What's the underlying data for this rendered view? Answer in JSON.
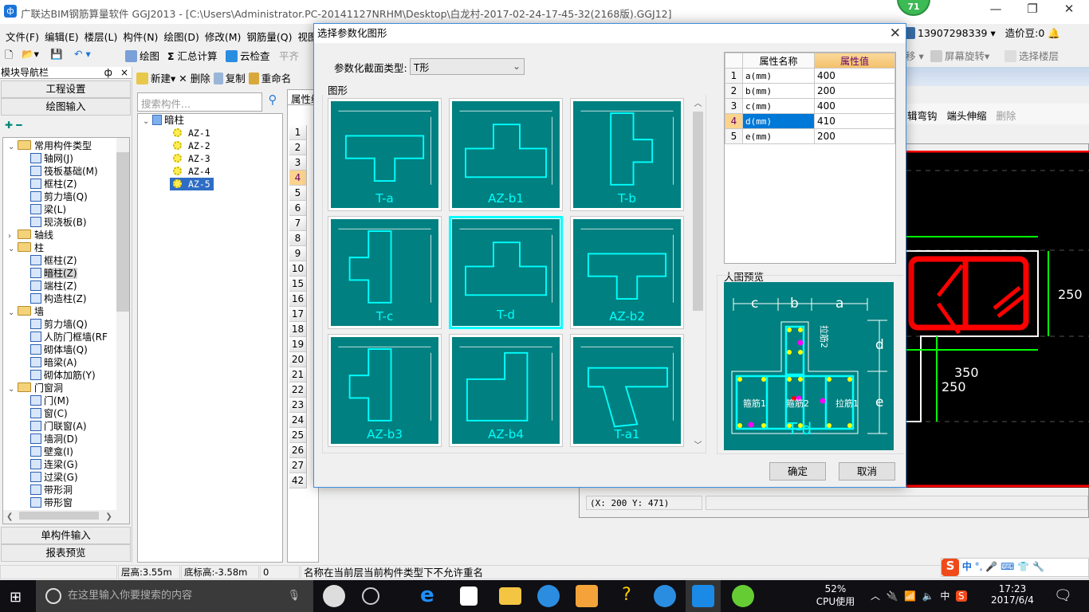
{
  "window": {
    "title": "广联达BIM钢筋算量软件 GGJ2013 - [C:\\Users\\Administrator.PC-20141127NRHM\\Desktop\\白龙村-2017-02-24-17-45-32(2168版).GGJ12]",
    "badge": "71",
    "minimize": "—",
    "restore": "❐",
    "close": "✕"
  },
  "menu": [
    "文件(F)",
    "编辑(E)",
    "楼层(L)",
    "构件(N)",
    "绘图(D)",
    "修改(M)",
    "钢筋量(Q)",
    "视图"
  ],
  "user": {
    "account": "13907298339",
    "beans": "造价豆:0"
  },
  "toolbar": {
    "draw": "绘图",
    "sum_icon": "Σ",
    "sum": "汇总计算",
    "cloud": "云检查",
    "align": "平齐",
    "move": "移",
    "rotate": "屏幕旋转",
    "select_floor": "选择楼层"
  },
  "right_toolbar": {
    "hook": "辑弯钩",
    "extend": "端头伸缩",
    "delete": "删除"
  },
  "leftnav": {
    "title": "模块导航栏",
    "pin": "ф",
    "close": "×",
    "project_settings": "工程设置",
    "draw_input": "绘图输入",
    "single_input": "单构件输入",
    "report": "报表预览",
    "tree": [
      {
        "label": "常用构件类型",
        "folder": true,
        "expanded": true
      },
      {
        "label": "轴网(J)"
      },
      {
        "label": "筏板基础(M)"
      },
      {
        "label": "框柱(Z)"
      },
      {
        "label": "剪力墙(Q)"
      },
      {
        "label": "梁(L)"
      },
      {
        "label": "现浇板(B)"
      },
      {
        "label": "轴线",
        "folder": true,
        "expanded": false
      },
      {
        "label": "柱",
        "folder": true,
        "expanded": true
      },
      {
        "label": "框柱(Z)"
      },
      {
        "label": "暗柱(Z)",
        "selected": true
      },
      {
        "label": "端柱(Z)"
      },
      {
        "label": "构造柱(Z)"
      },
      {
        "label": "墙",
        "folder": true,
        "expanded": true
      },
      {
        "label": "剪力墙(Q)"
      },
      {
        "label": "人防门框墙(RF"
      },
      {
        "label": "砌体墙(Q)"
      },
      {
        "label": "暗梁(A)"
      },
      {
        "label": "砌体加筋(Y)"
      },
      {
        "label": "门窗洞",
        "folder": true,
        "expanded": true
      },
      {
        "label": "门(M)"
      },
      {
        "label": "窗(C)"
      },
      {
        "label": "门联窗(A)"
      },
      {
        "label": "墙洞(D)"
      },
      {
        "label": "壁龛(I)"
      },
      {
        "label": "连梁(G)"
      },
      {
        "label": "过梁(G)"
      },
      {
        "label": "带形洞"
      },
      {
        "label": "带形窗"
      }
    ]
  },
  "components": {
    "new": "新建",
    "delete": "删除",
    "copy": "复制",
    "rename": "重命名",
    "search_placeholder": "搜索构件...",
    "root": "暗柱",
    "items": [
      "AZ-1",
      "AZ-2",
      "AZ-3",
      "AZ-4",
      "AZ-5"
    ],
    "selected": "AZ-5"
  },
  "property_grid": {
    "tab": "属性编",
    "rows": [
      "1",
      "2",
      "3",
      "4",
      "5",
      "6",
      "7",
      "8",
      "9",
      "10",
      "15",
      "16",
      "17",
      "18",
      "19",
      "20",
      "21",
      "22",
      "23",
      "24",
      "25",
      "26",
      "27",
      "42"
    ],
    "selected_row": "4"
  },
  "dialog": {
    "title": "选择参数化图形",
    "close": "✕",
    "type_label": "参数化截面类型:",
    "type_value": "T形",
    "shapes_label": "图形",
    "shapes": [
      "T-a",
      "AZ-b1",
      "T-b",
      "T-c",
      "T-d",
      "AZ-b2",
      "AZ-b3",
      "AZ-b4",
      "T-a1"
    ],
    "selected_shape": "T-d",
    "table": {
      "col_name": "属性名称",
      "col_value": "属性值",
      "rows": [
        {
          "n": "1",
          "name": "a(mm)",
          "value": "400"
        },
        {
          "n": "2",
          "name": "b(mm)",
          "value": "200"
        },
        {
          "n": "3",
          "name": "c(mm)",
          "value": "400"
        },
        {
          "n": "4",
          "name": "d(mm)",
          "value": "410"
        },
        {
          "n": "5",
          "name": "e(mm)",
          "value": "200"
        }
      ]
    },
    "preview_label": "大图预览",
    "preview": {
      "name": "T-d",
      "dims": [
        "c",
        "b",
        "a",
        "d",
        "e"
      ],
      "rebar": [
        "箍筋1",
        "箍筋2",
        "拉筋1",
        "拉筋2"
      ]
    },
    "ok": "确定",
    "cancel": "取消"
  },
  "cad": {
    "dims": [
      "250",
      "350",
      "250"
    ],
    "coords": "(X: 200 Y: 471)"
  },
  "statusbar": {
    "floor_height": "层高:3.55m",
    "base_elev": "底标高:-3.58m",
    "value": "0",
    "message": "名称在当前层当前构件类型下不允许重名"
  },
  "taskbar": {
    "search": "在这里输入你要搜索的内容",
    "cpu_pct": "52%",
    "cpu_label": "CPU使用",
    "ime": "中",
    "time": "17:23",
    "date": "2017/6/4"
  },
  "ime_bar": {
    "mode": "中",
    "punct": "°,"
  },
  "colors": {
    "teal": "#008080",
    "cyan": "#00ffff",
    "selection": "#0078d7"
  }
}
